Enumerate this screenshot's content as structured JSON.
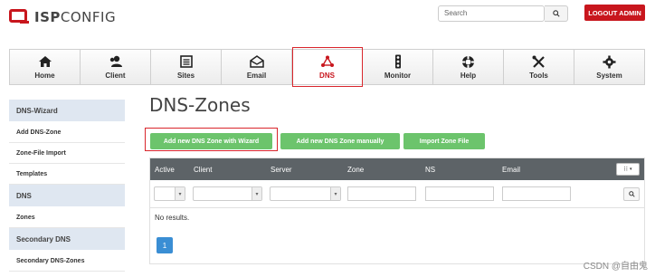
{
  "brand": {
    "logo_bold": "ISP",
    "logo_rest": "CONFIG",
    "red": "#c8161d"
  },
  "header": {
    "search_placeholder": "Search",
    "logout_label": "LOGOUT ADMIN"
  },
  "topnav": [
    {
      "label": "Home",
      "icon": "home-icon"
    },
    {
      "label": "Client",
      "icon": "client-icon"
    },
    {
      "label": "Sites",
      "icon": "sites-icon"
    },
    {
      "label": "Email",
      "icon": "email-icon"
    },
    {
      "label": "DNS",
      "icon": "dns-icon",
      "active": true
    },
    {
      "label": "Monitor",
      "icon": "monitor-icon"
    },
    {
      "label": "Help",
      "icon": "help-icon"
    },
    {
      "label": "Tools",
      "icon": "tools-icon"
    },
    {
      "label": "System",
      "icon": "system-icon"
    }
  ],
  "sidebar": {
    "wizard_head": "DNS-Wizard",
    "wizard_items": [
      "Add DNS-Zone",
      "Zone-File Import",
      "Templates"
    ],
    "dns_head": "DNS",
    "dns_items": [
      "Zones"
    ],
    "secondary_head": "Secondary DNS",
    "secondary_items": [
      "Secondary DNS-Zones"
    ]
  },
  "main": {
    "title": "DNS-Zones",
    "buttons": {
      "wizard": "Add new DNS Zone with Wizard",
      "manual": "Add new DNS Zone manually",
      "import": "Import Zone File"
    },
    "columns": [
      "Active",
      "Client",
      "Server",
      "Zone",
      "NS",
      "Email"
    ],
    "no_results": "No results.",
    "page": "1"
  },
  "watermark": "CSDN @自由鬼"
}
